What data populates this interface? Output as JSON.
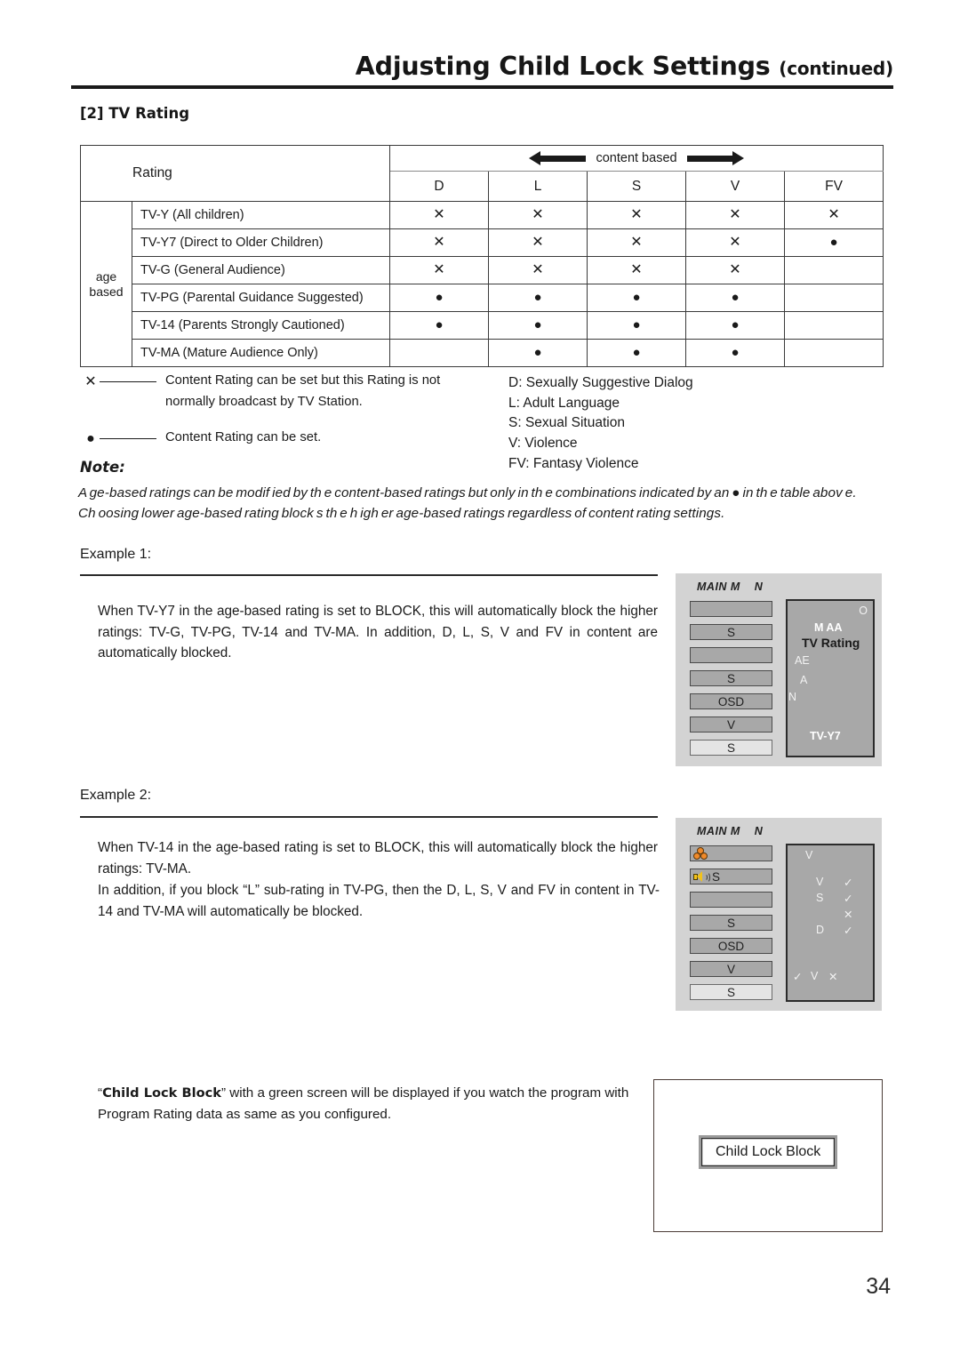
{
  "header": {
    "title": "Adjusting Child Lock Settings",
    "continued": "(continued)"
  },
  "section": {
    "heading": "[2] TV Rating"
  },
  "rating_table": {
    "corner_label": "Rating",
    "content_based_label": "content based",
    "age_based_label": "age\nbased",
    "content_columns": [
      "D",
      "L",
      "S",
      "V",
      "FV"
    ],
    "rows": [
      {
        "label": "TV-Y (All children)",
        "marks": [
          "x",
          "x",
          "x",
          "x",
          "x"
        ]
      },
      {
        "label": "TV-Y7 (Direct to Older Children)",
        "marks": [
          "x",
          "x",
          "x",
          "x",
          "dot"
        ]
      },
      {
        "label": "TV-G (General Audience)",
        "marks": [
          "x",
          "x",
          "x",
          "x",
          ""
        ]
      },
      {
        "label": "TV-PG (Parental Guidance Suggested)",
        "marks": [
          "dot",
          "dot",
          "dot",
          "dot",
          ""
        ]
      },
      {
        "label": "TV-14 (Parents Strongly Cautioned)",
        "marks": [
          "dot",
          "dot",
          "dot",
          "dot",
          ""
        ]
      },
      {
        "label": "TV-MA (Mature Audience Only)",
        "marks": [
          "",
          "dot",
          "dot",
          "dot",
          ""
        ]
      }
    ],
    "symbols": {
      "x": "✕",
      "dot": "●"
    }
  },
  "legend": {
    "x_symbol": "✕",
    "x_text_line1": "Content Rating can be set but this Rating is not",
    "x_text_line2": "normally broadcast by TV Station.",
    "dot_symbol": "●",
    "dot_text": "Content Rating can be set."
  },
  "definitions": [
    "D: Sexually Suggestive Dialog",
    "L: Adult  Language",
    "S: Sexual Situation",
    "V: Violence",
    "FV: Fantasy Violence"
  ],
  "note": {
    "label": "Note:",
    "line1": "A ge-based ratings can be modif ied by th e content-based ratings but only in th e combinations indicated by an ● in th e table abov e.",
    "line2": "Ch oosing lower age-based rating block s th e h igh er age-based ratings regardless of content rating settings."
  },
  "example1": {
    "label": "Example 1:",
    "paragraph": "When TV-Y7 in the age-based rating is set to BLOCK, this will automatically block the higher ratings: TV-G, TV-PG, TV-14 and TV-MA. In addition, D, L, S, V and FV in content are automatically blocked.",
    "menu": {
      "main_label": "MAIN M    N",
      "bars": [
        "",
        "S",
        "",
        "S",
        "OSD",
        "V",
        "S"
      ],
      "selected_index": 6,
      "panel": {
        "corner": "O",
        "row1": "M   AA",
        "title": "TV Rating",
        "frag1": "AE",
        "frag2": "A",
        "frag3": "N",
        "value": "TV-Y7"
      }
    }
  },
  "example2": {
    "label": "Example 2:",
    "paragraph_line1": "When TV-14 in the age-based rating is set to BLOCK, this will automatically block the higher ratings: TV-MA.",
    "paragraph_line2": "In addition, if you block “L” sub-rating in TV-PG, then the D, L, S, V and FV in content in TV-14 and TV-MA will automatically be blocked.",
    "menu": {
      "main_label": "MAIN M    N",
      "bars": [
        {
          "label": "",
          "icon": "color-wheel-icon"
        },
        {
          "label": "S",
          "icon": "speaker-icon"
        },
        {
          "label": "",
          "icon": ""
        },
        {
          "label": "S",
          "icon": ""
        },
        {
          "label": "OSD",
          "icon": ""
        },
        {
          "label": "V",
          "icon": ""
        },
        {
          "label": "S",
          "icon": ""
        }
      ],
      "selected_index": 6,
      "panel": {
        "top_frag": "V",
        "rows": [
          {
            "label": "V",
            "mark": "✓"
          },
          {
            "label": "S",
            "mark": "✓"
          },
          {
            "label": "",
            "mark": "✕"
          },
          {
            "label": "D",
            "mark": "✓"
          }
        ],
        "footer": [
          "✓",
          "V",
          "✕"
        ]
      }
    }
  },
  "child_lock": {
    "text_bold": "Child Lock Block",
    "text_prefix": "“",
    "text_rest": "” with a green screen will be displayed if you watch the program with Program Rating data as same as you configured.",
    "screen_button": "Child Lock Block"
  },
  "page_number": "34",
  "colors": {
    "accent_orange": "#f08a2a",
    "accent_yellow": "#f2c21a",
    "menu_gray": "#a8a8a8",
    "panel_bg": "#d3d3d3"
  }
}
